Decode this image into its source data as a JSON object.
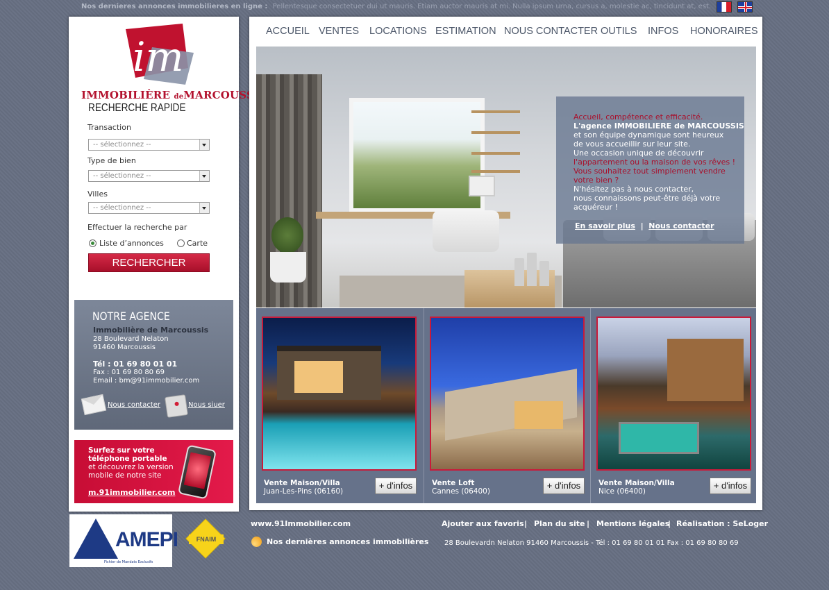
{
  "ticker": {
    "label": "Nos dernieres annonces immobilieres en ligne :",
    "text": "Pellentesque consectetuer dui ut mauris. Etiam auctor mauris at mi. Nulla ipsum urna, cursus a, molestie ac, tincidunt at, est. Cura..."
  },
  "languages": [
    "fr-flag-icon",
    "uk-flag-icon"
  ],
  "brand": {
    "logo_letters": "im",
    "name_part1": "IMMOBILIÈRE",
    "name_de": "de",
    "name_part2": "MARCOUSSIS",
    "color": "#b3122e"
  },
  "search": {
    "title": "RECHERCHE RAPIDE",
    "transaction_label": "Transaction",
    "transaction_value": "-- sélectionnez --",
    "type_label": "Type de bien",
    "type_value": "-- sélectionnez --",
    "villes_label": "Villes",
    "villes_value": "-- sélectionnez --",
    "mode_label": "Effectuer la recherche par",
    "option_list": "Liste d’annonces",
    "option_map": "Carte",
    "selected_option": "Liste d’annonces",
    "button": "RECHERCHER"
  },
  "agency": {
    "title": "NOTRE AGENCE",
    "name": "Immobilière de Marcoussis",
    "address1": "28 Boulevard Nelaton",
    "address2": "91460 Marcoussis",
    "tel": "Tél : 01 69 80 01 01",
    "fax": "Fax : 01 69 80 80 69",
    "email": "Email : bm@91immobilier.com",
    "contact_link": "Nous contacter",
    "locate_link": "Nous siuer"
  },
  "mobile": {
    "line1": "Surfez sur votre",
    "line2": "téléphone portable",
    "line3": "et découvrez la version",
    "line4": "mobile de notre site",
    "url": "m.91immobilier.com"
  },
  "nav": [
    "ACCUEIL",
    "VENTES",
    "LOCATIONS",
    "ESTIMATION",
    "NOUS CONTACTER",
    "OUTILS",
    "INFOS",
    "HONORAIRES"
  ],
  "hero": {
    "l1": "Accueil, compétence et efficacité.",
    "l2": "L'agence IMMOBILIERE de MARCOUSSIS",
    "l3": "et son équipe dynamique sont heureux",
    "l4": "de vous accueillir sur leur site.",
    "l5": "Une occasion unique de découvrir",
    "l6": "l'appartement ou la maison de vos rêves !",
    "l7": "Vous souhaitez tout simplement vendre",
    "l8": "votre bien ?",
    "l9": "N'hésitez pas à nous contacter,",
    "l10": "nous connaissons peut-être déjà votre",
    "l11": "acquéreur !",
    "more_link": "En savoir plus",
    "separator": "|",
    "contact_link": "Nous contacter"
  },
  "listings": [
    {
      "title": "Vente Maison/Villa",
      "location": "Juan-Les-Pins (06160)",
      "button": "+ d'infos"
    },
    {
      "title": "Vente Loft",
      "location": "Cannes (06400)",
      "button": "+ d'infos"
    },
    {
      "title": "Vente Maison/Villa",
      "location": "Nice (06400)",
      "button": "+ d'infos"
    }
  ],
  "footer": {
    "amepi": "AMEPI",
    "amepi_sub": "Fichier de Mandats Exclusifs",
    "fnaim": "FNAIM",
    "site": "www.91Immobilier.com",
    "rss_label": "Nos dernières annonces immobilières",
    "favorites": "Ajouter aux favoris",
    "sitemap": "Plan du site",
    "legal": "Mentions légales",
    "credit": "Réalisation : SeLoger",
    "sep": "|",
    "address": "28 Boulevardn Nelaton 91460 Marcoussis  -  Tél : 01 69 80 01 01  Fax : 01 69 80 80 69"
  }
}
